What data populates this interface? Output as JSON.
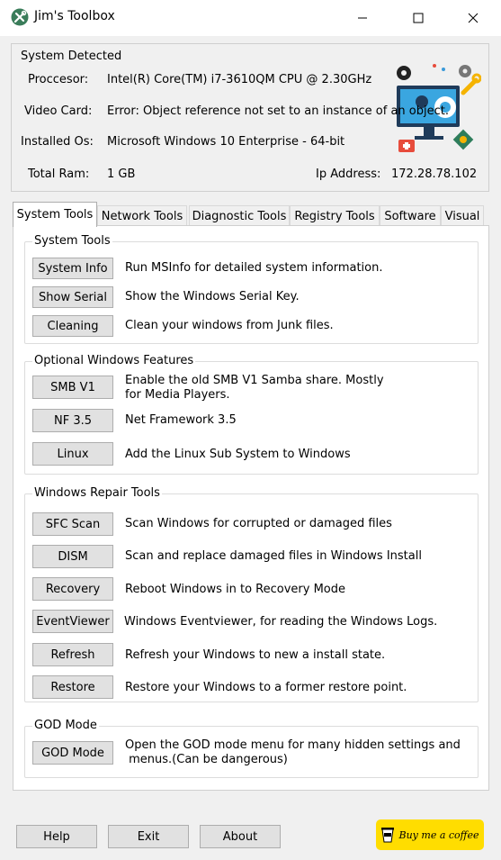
{
  "window": {
    "title": "Jim's Toolbox",
    "minimize_icon": "minimize-icon",
    "maximize_icon": "maximize-icon",
    "close_icon": "close-icon"
  },
  "system": {
    "legend": "System Detected",
    "rows": [
      {
        "label": "Proccesor:",
        "value": "Intel(R) Core(TM) i7-3610QM CPU @ 2.30GHz"
      },
      {
        "label": "Video Card:",
        "value": "Error: Object reference not set to an instance of an object."
      },
      {
        "label": "Installed Os:",
        "value": "Microsoft Windows 10 Enterprise - 64-bit"
      },
      {
        "label": "Total Ram:",
        "value": "1 GB"
      }
    ],
    "ip_label": "Ip Address:",
    "ip_value": "172.28.78.102",
    "illustration_icon": "computer-tools-illustration-icon"
  },
  "tabs": [
    "System Tools",
    "Network Tools",
    "Diagnostic Tools",
    "Registry Tools",
    "Software",
    "Visual"
  ],
  "active_tab": "System Tools",
  "groups": {
    "system_tools": {
      "legend": "System Tools",
      "items": [
        {
          "button": "System Info",
          "desc": "Run MSInfo for detailed system information."
        },
        {
          "button": "Show Serial",
          "desc": "Show the Windows Serial Key."
        },
        {
          "button": "Cleaning",
          "desc": "Clean your windows from Junk files."
        }
      ]
    },
    "optional_features": {
      "legend": "Optional Windows Features",
      "items": [
        {
          "button": "SMB V1",
          "desc": "Enable the old SMB V1 Samba share. Mostly",
          "desc2": "for Media Players."
        },
        {
          "button": "NF 3.5",
          "desc": "Net Framework 3.5"
        },
        {
          "button": "Linux",
          "desc": "Add the Linux Sub System to Windows"
        }
      ]
    },
    "repair_tools": {
      "legend": "Windows Repair Tools",
      "items": [
        {
          "button": "SFC Scan",
          "desc": "Scan Windows for corrupted or damaged files"
        },
        {
          "button": "DISM",
          "desc": "Scan and replace damaged files in Windows Install"
        },
        {
          "button": "Recovery",
          "desc": "Reboot Windows in to Recovery Mode"
        },
        {
          "button": "EventViewer",
          "desc": "Windows Eventviewer, for reading the Windows Logs."
        },
        {
          "button": "Refresh",
          "desc": "Refresh your Windows to new a install state."
        },
        {
          "button": "Restore",
          "desc": "Restore your Windows to a former restore point."
        }
      ]
    },
    "god_mode": {
      "legend": "GOD Mode",
      "items": [
        {
          "button": "GOD Mode",
          "desc": "Open the GOD mode menu for many hidden settings and",
          "desc2": " menus.(Can be dangerous)"
        }
      ]
    }
  },
  "footer": {
    "help": "Help",
    "exit": "Exit",
    "about": "About",
    "coffee": "Buy me a coffee",
    "coffee_icon": "coffee-cup-icon"
  },
  "colors": {
    "window_bg": "#f0f0f0",
    "panel_bg": "#ffffff",
    "button_bg": "#e1e1e1",
    "coffee_bg": "#ffdd00"
  }
}
